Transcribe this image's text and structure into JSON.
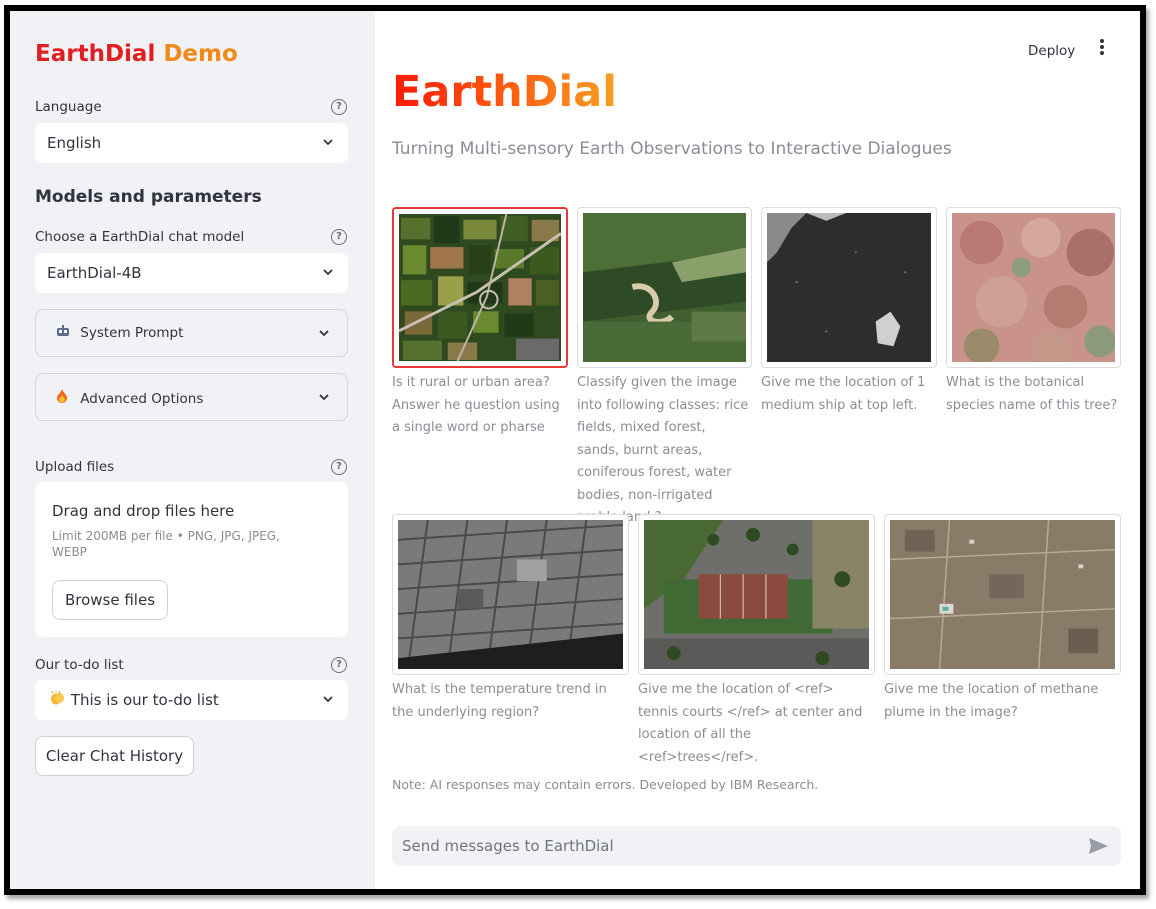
{
  "sidebar": {
    "title_part1": "EarthDial",
    "title_part2": "Demo",
    "language": {
      "label": "Language",
      "value": "English"
    },
    "models_heading": "Models and parameters",
    "model": {
      "label": "Choose a EarthDial chat model",
      "value": "EarthDial-4B"
    },
    "system_prompt": {
      "icon": "robot-icon",
      "label": "System Prompt"
    },
    "advanced": {
      "icon": "fire-icon",
      "label": "Advanced Options"
    },
    "upload": {
      "label": "Upload files",
      "drop_text": "Drag and drop files here",
      "limit_text": "Limit 200MB per file • PNG, JPG, JPEG, WEBP",
      "browse_label": "Browse files"
    },
    "todo": {
      "label": "Our to-do list",
      "icon": "clapping-hands-icon",
      "value": "This is our to-do list"
    },
    "clear_label": "Clear Chat History"
  },
  "header": {
    "deploy_label": "Deploy"
  },
  "main": {
    "title": "EarthDial",
    "subtitle": "Turning Multi-sensory Earth Observations to Interactive Dialogues",
    "examples": [
      {
        "caption": "Is it rural or urban area? Answer he question using a single word or pharse"
      },
      {
        "caption": "Classify given the image into following classes: rice fields, mixed forest, sands, burnt areas, coniferous forest, water bodies, non-irrigated arable land ?"
      },
      {
        "caption": "Give me the location of 1 medium ship at top left."
      },
      {
        "caption": "What is the botanical species name of this tree?"
      },
      {
        "caption": "What is the temperature trend in the underlying region?"
      },
      {
        "caption": "Give me the location of <ref> tennis courts </ref> at center and location of all the <ref>trees</ref>."
      },
      {
        "caption": "Give me the location of methane plume in the image?"
      }
    ],
    "note": "Note: AI responses may contain errors. Developed by IBM Research.",
    "chat_placeholder": "Send messages to EarthDial"
  },
  "colors": {
    "accent_red": "#e02020",
    "accent_orange": "#f08a1a",
    "sidebar_bg": "#f0f2f6",
    "selected_border": "#e53935"
  }
}
